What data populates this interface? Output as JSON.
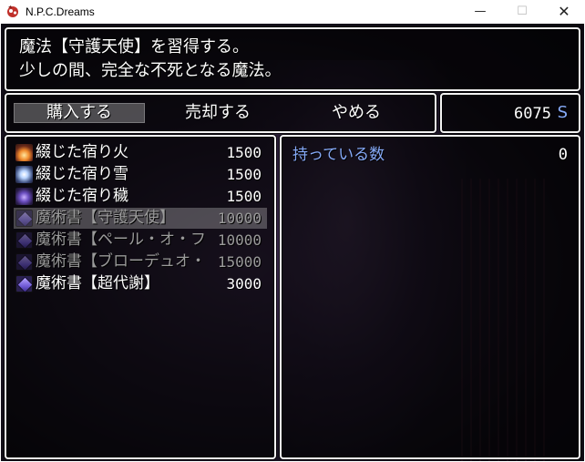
{
  "window": {
    "title": "N.P.C.Dreams",
    "minimize_glyph": "—",
    "maximize_glyph": "☐",
    "close_glyph": "✕"
  },
  "help": {
    "line1": "魔法【守護天使】を習得する。",
    "line2": "少しの間、完全な不死となる魔法。"
  },
  "commands": [
    {
      "label": "購入する",
      "selected": true
    },
    {
      "label": "売却する",
      "selected": false
    },
    {
      "label": "やめる",
      "selected": false
    }
  ],
  "gold": {
    "value": "6075",
    "unit": "S"
  },
  "items": [
    {
      "name": "綴じた宿り火",
      "price": "1500",
      "icon": "fire-crystal-icon",
      "enabled": true
    },
    {
      "name": "綴じた宿り雪",
      "price": "1500",
      "icon": "snow-crystal-icon",
      "enabled": true
    },
    {
      "name": "綴じた宿り穢",
      "price": "1500",
      "icon": "dark-crystal-icon",
      "enabled": true
    },
    {
      "name": "魔術書【守護天使】",
      "price": "10000",
      "icon": "spellbook-icon",
      "enabled": false
    },
    {
      "name": "魔術書【ペール・オ・フェ",
      "price": "10000",
      "icon": "spellbook-icon",
      "enabled": false
    },
    {
      "name": "魔術書【ブローデュオ・ア",
      "price": "15000",
      "icon": "spellbook-icon",
      "enabled": false
    },
    {
      "name": "魔術書【超代謝】",
      "price": "3000",
      "icon": "spellbook-icon",
      "enabled": true
    }
  ],
  "selected_item_index": 3,
  "status": {
    "possess_label": "持っている数",
    "possess_count": "0"
  },
  "colors": {
    "system_blue": "#86aaf8",
    "window_border": "#f2f2f2",
    "disabled_text": "#9a9a9a"
  }
}
